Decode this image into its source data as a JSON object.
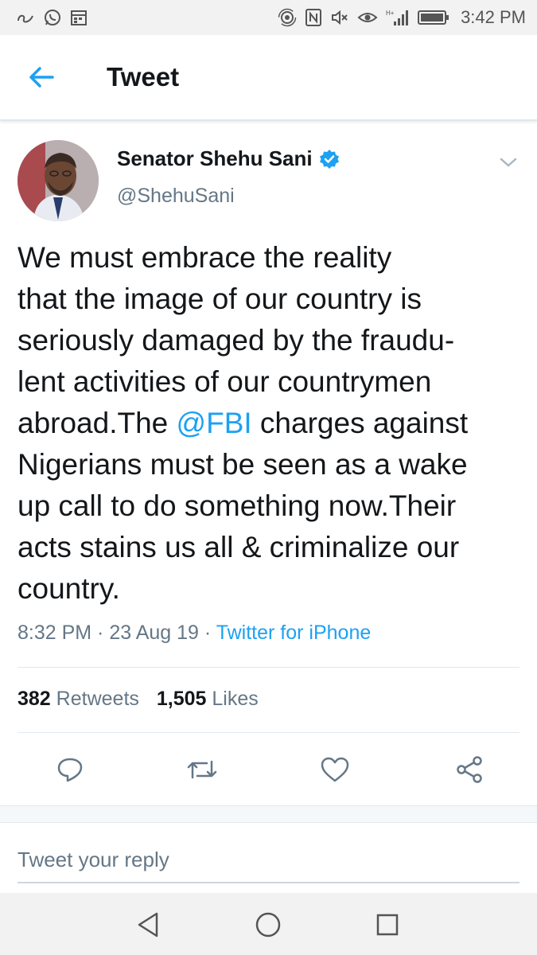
{
  "status_bar": {
    "time": "3:42 PM",
    "left_icons": [
      "link-icon",
      "whatsapp-icon",
      "calendar-icon"
    ],
    "right_icons": [
      "hotspot-icon",
      "nfc-icon",
      "mute-icon",
      "eye-icon",
      "signal-icon",
      "battery-icon"
    ]
  },
  "header": {
    "back_icon": "arrow-left-icon",
    "title": "Tweet"
  },
  "tweet": {
    "author_name": "Senator Shehu Sani",
    "verified_icon": "verified-badge-icon",
    "handle": "@ShehuSani",
    "text_before_mention": "We must embrace the reality\nthat the image of our country is\nseriously damaged by the fraudu-\nlent activities of our countrymen\nabroad.The ",
    "mention": "@FBI",
    "text_after_mention": " charges against\nNigerians must be seen as a wake\nup call to do something now.Their\nacts stains us all & criminalize our\ncountry.",
    "time": "8:32 PM",
    "separator": " · ",
    "date": "23 Aug 19",
    "source": "Twitter for iPhone",
    "retweets_count": "382",
    "retweets_label": "Retweets",
    "likes_count": "1,505",
    "likes_label": "Likes"
  },
  "actions": [
    "reply-icon",
    "retweet-icon",
    "like-icon",
    "share-icon"
  ],
  "reply": {
    "placeholder": "Tweet your reply"
  },
  "nav": [
    "back-triangle-icon",
    "home-circle-icon",
    "recents-square-icon"
  ],
  "colors": {
    "accent": "#1da1f2",
    "text": "#14171a",
    "muted": "#657786",
    "divider": "#e1e8ed"
  }
}
